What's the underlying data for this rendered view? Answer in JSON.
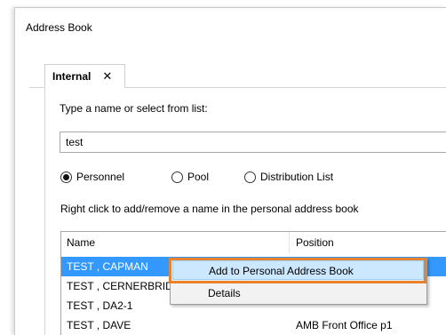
{
  "window": {
    "title": "Address Book"
  },
  "tabs": [
    {
      "label": "Internal",
      "close_glyph": "✕"
    }
  ],
  "search": {
    "prompt": "Type a name or select from list:",
    "value": "test"
  },
  "radio_group": {
    "options": [
      {
        "label": "Personnel",
        "selected": true
      },
      {
        "label": "Pool",
        "selected": false
      },
      {
        "label": "Distribution List",
        "selected": false
      }
    ]
  },
  "hint": "Right click to add/remove a name in the personal address book",
  "list": {
    "columns": [
      "Name",
      "Position"
    ],
    "rows": [
      {
        "name": "TEST , CAPMAN",
        "position": "",
        "selected": true
      },
      {
        "name": "TEST , CERNERBRIDG",
        "position": ""
      },
      {
        "name": "TEST , DA2-1",
        "position": ""
      },
      {
        "name": "TEST , DAVE",
        "position": "AMB Front Office p1"
      }
    ]
  },
  "context_menu": {
    "items": [
      {
        "label": "Add to Personal Address Book",
        "highlighted": true
      },
      {
        "label": "Details",
        "highlighted": false
      }
    ]
  },
  "colors": {
    "selection": "#3399ff",
    "menu_highlight": "#cce8ff",
    "focus_outline": "#e8822c"
  }
}
